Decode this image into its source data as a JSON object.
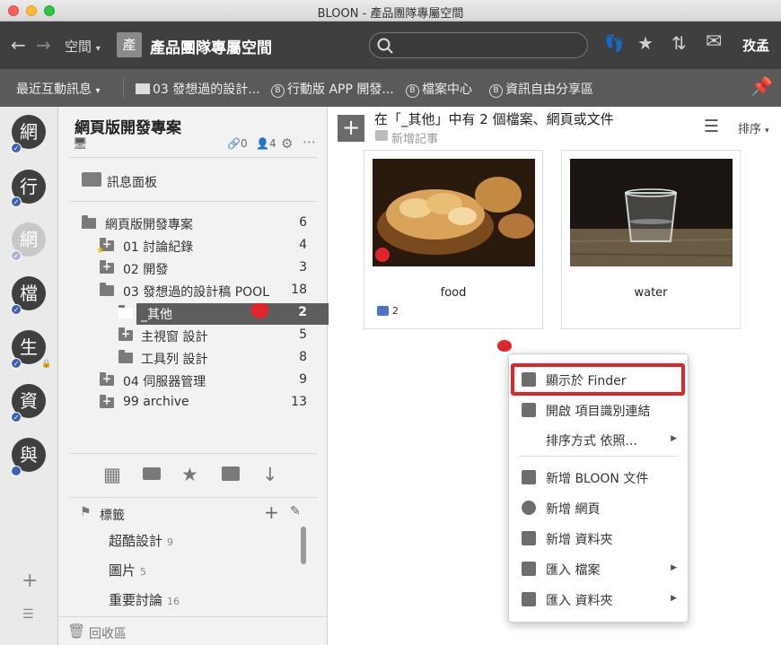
{
  "window": {
    "title": "BLOON - 產品團隊專屬空間"
  },
  "toolbar": {
    "space_label": "空間",
    "space_avatar": "產",
    "space_name": "產品團隊專屬空間",
    "user_name": "孜孟"
  },
  "bookmarks": {
    "recent": "最近互動訊息",
    "items": [
      "03 發想過的設計...",
      "行動版 APP 開發...",
      "檔案中心",
      "資訊自由分享區"
    ]
  },
  "rail": {
    "spaces": [
      "網",
      "行",
      "網",
      "檔",
      "生",
      "資",
      "與"
    ]
  },
  "sidebar": {
    "project_title": "網頁版開發專案",
    "stats": {
      "links": "0",
      "members": "4"
    },
    "message_board": "訊息面板",
    "tree": [
      {
        "label": "網頁版開發專案",
        "count": "6"
      },
      {
        "label": "01 討論紀錄",
        "count": "4"
      },
      {
        "label": "02 開發",
        "count": "3"
      },
      {
        "label": "03 發想過的設計稿 POOL",
        "count": "18"
      },
      {
        "label": "_其他",
        "count": "2"
      },
      {
        "label": "主視窗 設計",
        "count": "5"
      },
      {
        "label": "工具列 設計",
        "count": "8"
      },
      {
        "label": "04 伺服器管理",
        "count": "9"
      },
      {
        "label": "99 archive",
        "count": "13"
      }
    ],
    "tags_title": "標籤",
    "tags": [
      {
        "label": "超酷設計",
        "count": "9"
      },
      {
        "label": "圖片",
        "count": "5"
      },
      {
        "label": "重要討論",
        "count": "16"
      }
    ],
    "trash": "回收區"
  },
  "main": {
    "heading": "在「_其他」中有 2 個檔案、網頁或文件",
    "new_note": "新增記事",
    "sort_label": "排序",
    "cards": [
      {
        "name": "food",
        "comments": "2"
      },
      {
        "name": "water",
        "comments": ""
      }
    ]
  },
  "context_menu": {
    "items": [
      {
        "label": "顯示於 Finder",
        "icon": "finder-icon"
      },
      {
        "label": "開啟 項目識別連結",
        "icon": "link-icon"
      },
      {
        "label": "排序方式 依照...",
        "icon": ""
      },
      {
        "label": "新增 BLOON 文件",
        "icon": "document-icon"
      },
      {
        "label": "新增 網頁",
        "icon": "globe-icon"
      },
      {
        "label": "新增 資料夾",
        "icon": "folder-plus-icon"
      },
      {
        "label": "匯入 檔案",
        "icon": "import-file-icon"
      },
      {
        "label": "匯入 資料夾",
        "icon": "import-folder-icon"
      }
    ]
  },
  "colors": {
    "accent_blue": "#3d5fb8",
    "highlight_red": "#e0262a",
    "toolbar": "#3f3f3f"
  }
}
